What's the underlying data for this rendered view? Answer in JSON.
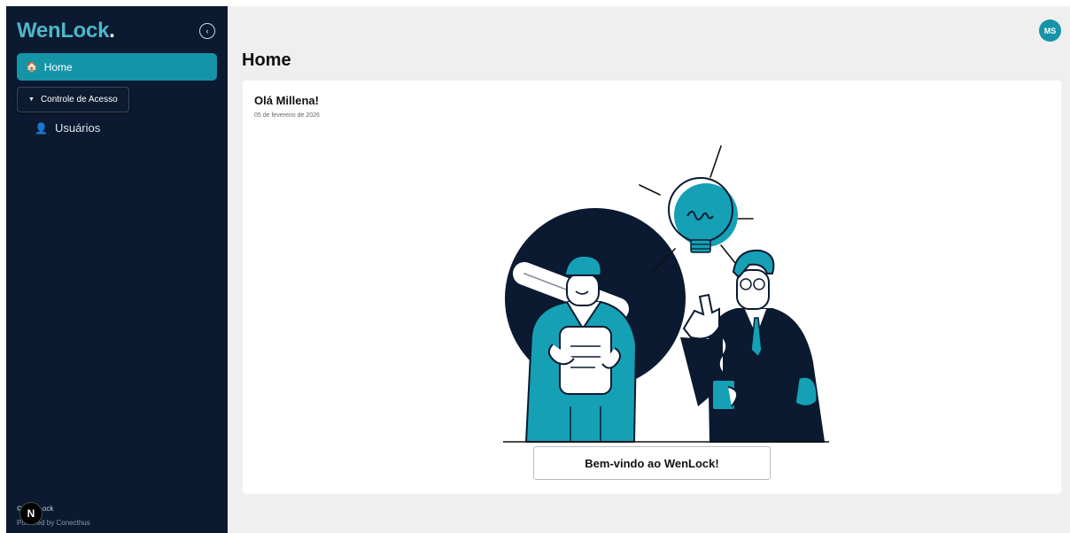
{
  "sidebar": {
    "logo_text": "WenLock",
    "logo_dot": ".",
    "collapse_icon": "‹",
    "home_label": "Home",
    "group_label": "Controle de Acesso",
    "users_label": "Usuários",
    "footer_line1": "© WenLock",
    "footer_line2": "Powered by Conecthus",
    "dev_badge": "N"
  },
  "header": {
    "avatar_initials": "MS",
    "page_title": "Home"
  },
  "card": {
    "greeting": "Olá Millena!",
    "date": "05 de fevereiro de 2026",
    "welcome_button": "Bem-vindo ao WenLock!"
  },
  "colors": {
    "sidebar_bg": "#0b1a30",
    "accent": "#1594a8",
    "illustration_dark": "#0b1a30",
    "illustration_teal": "#16a0b5"
  }
}
